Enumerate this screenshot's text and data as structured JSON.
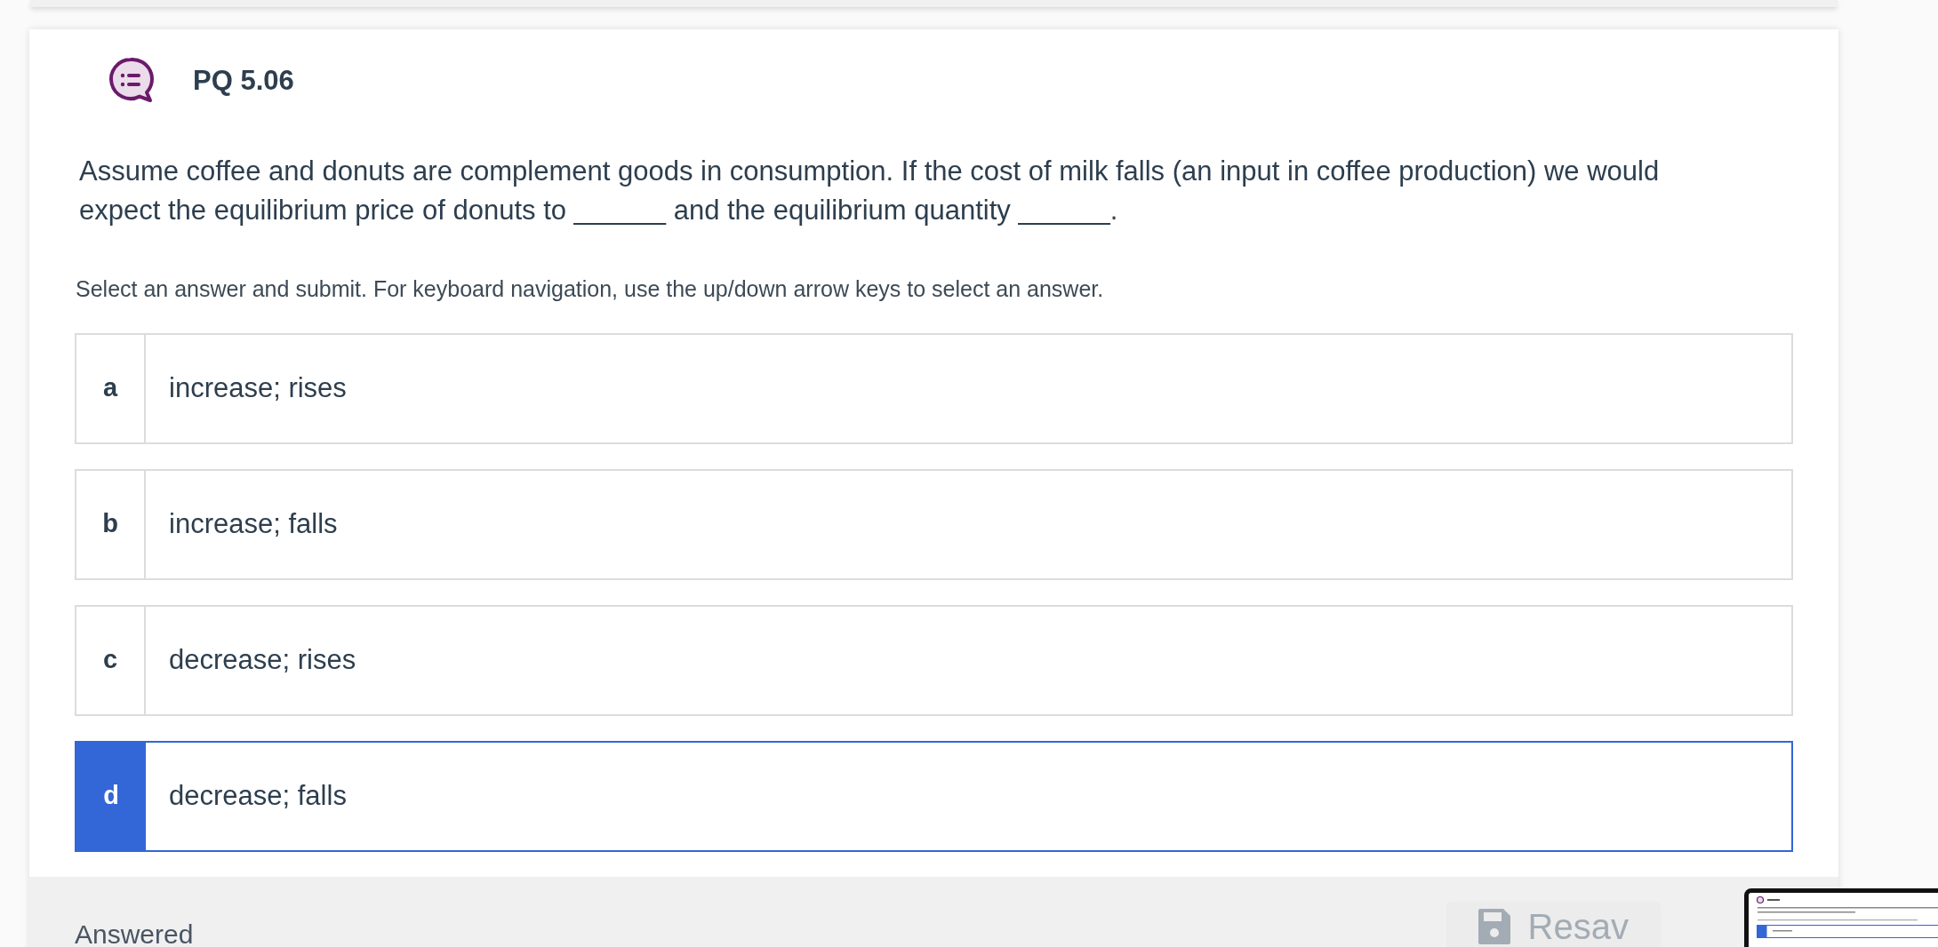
{
  "question": {
    "title": "PQ 5.06",
    "text": "Assume coffee and donuts are complement goods in consumption. If the cost of milk falls (an input in coffee production)  we would expect the equilibrium price of donuts to ______ and the equilibrium quantity ______.",
    "instructions": "Select an answer and submit. For keyboard navigation, use the up/down arrow keys to select an answer."
  },
  "options": [
    {
      "letter": "a",
      "text": "increase; rises",
      "selected": false
    },
    {
      "letter": "b",
      "text": "increase; falls",
      "selected": false
    },
    {
      "letter": "c",
      "text": "decrease; rises",
      "selected": false
    },
    {
      "letter": "d",
      "text": "decrease; falls",
      "selected": true
    }
  ],
  "footer": {
    "status": "Answered",
    "resave_button": "Resav"
  }
}
